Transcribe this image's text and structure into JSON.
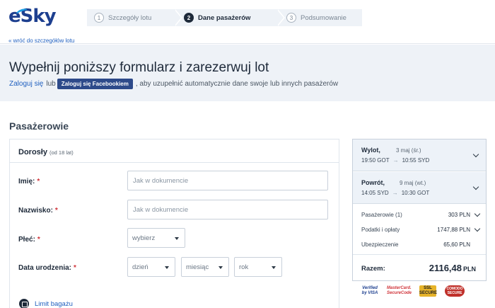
{
  "header": {
    "logo": "eSky",
    "steps": [
      {
        "num": "1",
        "label": "Szczegóły lotu"
      },
      {
        "num": "2",
        "label": "Dane pasażerów"
      },
      {
        "num": "3",
        "label": "Podsumowanie"
      }
    ],
    "back_link": "« wróć do szczegółów lotu"
  },
  "hero": {
    "title": "Wypełnij poniższy formularz i zarezerwuj lot",
    "login_link": "Zaloguj się",
    "or_text": "lub",
    "facebook_button": "Zaloguj się Facebookiem",
    "suffix": ", aby uzupełnić automatycznie dane swoje lub innych pasażerów"
  },
  "section_title": "Pasażerowie",
  "form": {
    "title": "Dorosły",
    "subtitle": "(od 18 lat)",
    "required_mark": "*",
    "first_name": {
      "label": "Imię:",
      "placeholder": "Jak w dokumencie"
    },
    "last_name": {
      "label": "Nazwisko:",
      "placeholder": "Jak w dokumencie"
    },
    "gender": {
      "label": "Płeć:",
      "value": "wybierz"
    },
    "birth_date": {
      "label": "Data urodzenia:",
      "day": "dzień",
      "month": "miesiąc",
      "year": "rok"
    },
    "baggage_link": "Limit bagażu"
  },
  "summary": {
    "outbound": {
      "name": "Wylot,",
      "date": "3 maj (śr.)",
      "dep": "19:50 GOT",
      "arrow": "→",
      "arr": "10:55 SYD"
    },
    "return": {
      "name": "Powrót,",
      "date": "9 maj (wt.)",
      "dep": "14:05 SYD",
      "arrow": "→",
      "arr": "10:30 GOT"
    },
    "costs": [
      {
        "label": "Pasażerowie (1)",
        "value": "303 PLN"
      },
      {
        "label": "Podatki i opłaty",
        "value": "1747,88 PLN"
      },
      {
        "label": "Ubezpieczenie",
        "value": "65,60 PLN"
      }
    ],
    "total_label": "Razem:",
    "total_value": "2116,48",
    "total_currency": "PLN"
  },
  "badges": {
    "visa": "Verified by VISA",
    "mastercard": "MasterCard. SecureCode",
    "ssl": "SSL SECURE",
    "comodo": "COMODO SECURE"
  },
  "colors": {
    "brand": "#1d3f8f",
    "link": "#1f5fbf",
    "hero_bg": "#eef2f7",
    "required": "#d0343a",
    "facebook": "#2d4a8a"
  }
}
